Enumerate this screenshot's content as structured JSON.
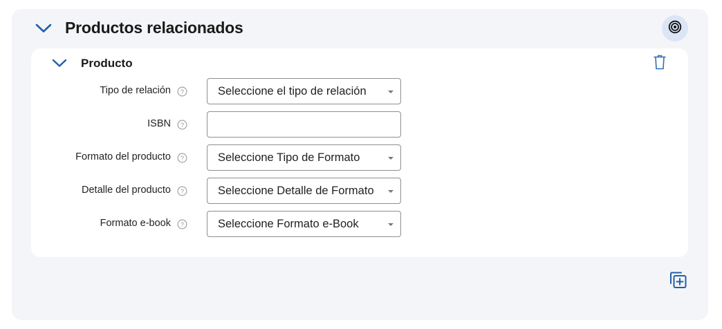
{
  "section": {
    "title": "Productos relacionados",
    "collapse_icon": "chevron-down-icon",
    "target_icon": "target-icon"
  },
  "product": {
    "title": "Producto",
    "delete_icon": "trash-icon",
    "fields": [
      {
        "label": "Tipo de relación",
        "value": "Seleccione el tipo de relación",
        "type": "select"
      },
      {
        "label": "ISBN",
        "value": "",
        "type": "text"
      },
      {
        "label": "Formato del producto",
        "value": "Seleccione Tipo de Formato",
        "type": "select"
      },
      {
        "label": "Detalle del producto",
        "value": "Seleccione Detalle de Formato",
        "type": "select"
      },
      {
        "label": "Formato e-book",
        "value": "Seleccione Formato e-Book",
        "type": "select"
      }
    ]
  },
  "footer": {
    "add_icon": "add-copy-icon"
  },
  "colors": {
    "accent": "#1f5fa8",
    "panel_bg": "#f4f5f8",
    "card_bg": "#ffffff",
    "target_bg": "#dce5f5"
  }
}
